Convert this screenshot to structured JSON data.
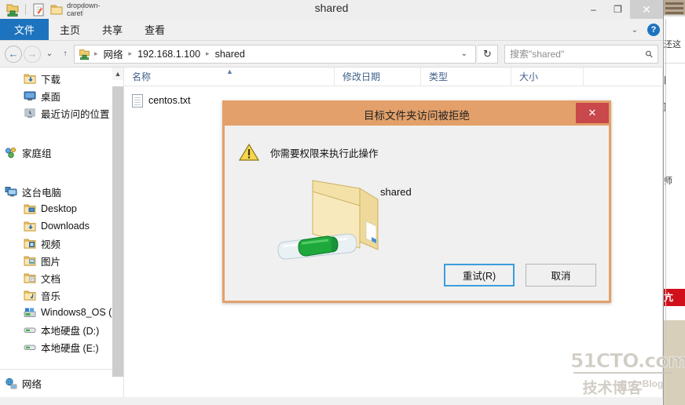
{
  "window": {
    "title": "shared",
    "quick_access": [
      "shared-folder-icon",
      "properties-icon",
      "new-folder-icon",
      "dropdown-caret"
    ],
    "minimize": "–",
    "maximize": "❐",
    "close": "✕"
  },
  "ribbon": {
    "tabs": [
      {
        "label": "文件",
        "active": true
      },
      {
        "label": "主页",
        "active": false
      },
      {
        "label": "共享",
        "active": false
      },
      {
        "label": "查看",
        "active": false
      }
    ],
    "collapse_caret": "⌄",
    "help": "?"
  },
  "address": {
    "back": "←",
    "forward": "→",
    "recent": "⌄",
    "up": "↑",
    "crumbs": [
      "网络",
      "192.168.1.100",
      "shared"
    ],
    "separator": "▸",
    "dropdown": "⌄",
    "refresh": "↻"
  },
  "search": {
    "placeholder": "搜索\"shared\"",
    "icon": "search-icon"
  },
  "sidebar": {
    "groups": [
      {
        "items": [
          {
            "label": "下载",
            "icon": "download-folder-icon",
            "level": 2
          },
          {
            "label": "桌面",
            "icon": "desktop-icon",
            "level": 2
          },
          {
            "label": "最近访问的位置",
            "icon": "recent-places-icon",
            "level": 2
          }
        ]
      },
      {
        "items": [
          {
            "label": "家庭组",
            "icon": "homegroup-icon",
            "level": 1
          }
        ]
      },
      {
        "items": [
          {
            "label": "这台电脑",
            "icon": "this-pc-icon",
            "level": 1
          },
          {
            "label": "Desktop",
            "icon": "folder-desktop-icon",
            "level": 2
          },
          {
            "label": "Downloads",
            "icon": "folder-downloads-icon",
            "level": 2
          },
          {
            "label": "视频",
            "icon": "folder-videos-icon",
            "level": 2
          },
          {
            "label": "图片",
            "icon": "folder-pictures-icon",
            "level": 2
          },
          {
            "label": "文档",
            "icon": "folder-documents-icon",
            "level": 2
          },
          {
            "label": "音乐",
            "icon": "folder-music-icon",
            "level": 2
          },
          {
            "label": "Windows8_OS (",
            "icon": "system-drive-icon",
            "level": 2
          },
          {
            "label": "本地硬盘 (D:)",
            "icon": "drive-icon",
            "level": 2
          },
          {
            "label": "本地硬盘 (E:)",
            "icon": "drive-icon",
            "level": 2
          }
        ]
      }
    ],
    "footer": {
      "label": "网络",
      "icon": "network-icon"
    }
  },
  "columns": [
    {
      "label": "名称",
      "key": "name"
    },
    {
      "label": "修改日期",
      "key": "date"
    },
    {
      "label": "类型",
      "key": "type"
    },
    {
      "label": "大小",
      "key": "size"
    }
  ],
  "files": [
    {
      "name": "centos.txt",
      "icon": "text-file-icon",
      "date": "",
      "type": "",
      "size": ""
    }
  ],
  "dialog": {
    "title": "目标文件夹访问被拒绝",
    "close": "✕",
    "message": "你需要权限来执行此操作",
    "icon": "warning-icon",
    "folder_icon": "shared-folder-network-icon",
    "folder_label": "shared",
    "buttons": [
      {
        "label": "重试(R)",
        "focused": true,
        "name": "retry-button"
      },
      {
        "label": "取消",
        "focused": false,
        "name": "cancel-button"
      }
    ]
  },
  "watermark": {
    "line1": "51CTO.com",
    "line2": "技术博客",
    "line2_sup": "Blog"
  },
  "background": {
    "text1": "还这",
    "text2": "师",
    "text3": "亢",
    "text4": "|",
    "text5": "]"
  },
  "colors": {
    "accent": "#1e73be",
    "dialog_frame": "#e3a06a",
    "close_red": "#c9484b",
    "focus_blue": "#3a9ede"
  }
}
